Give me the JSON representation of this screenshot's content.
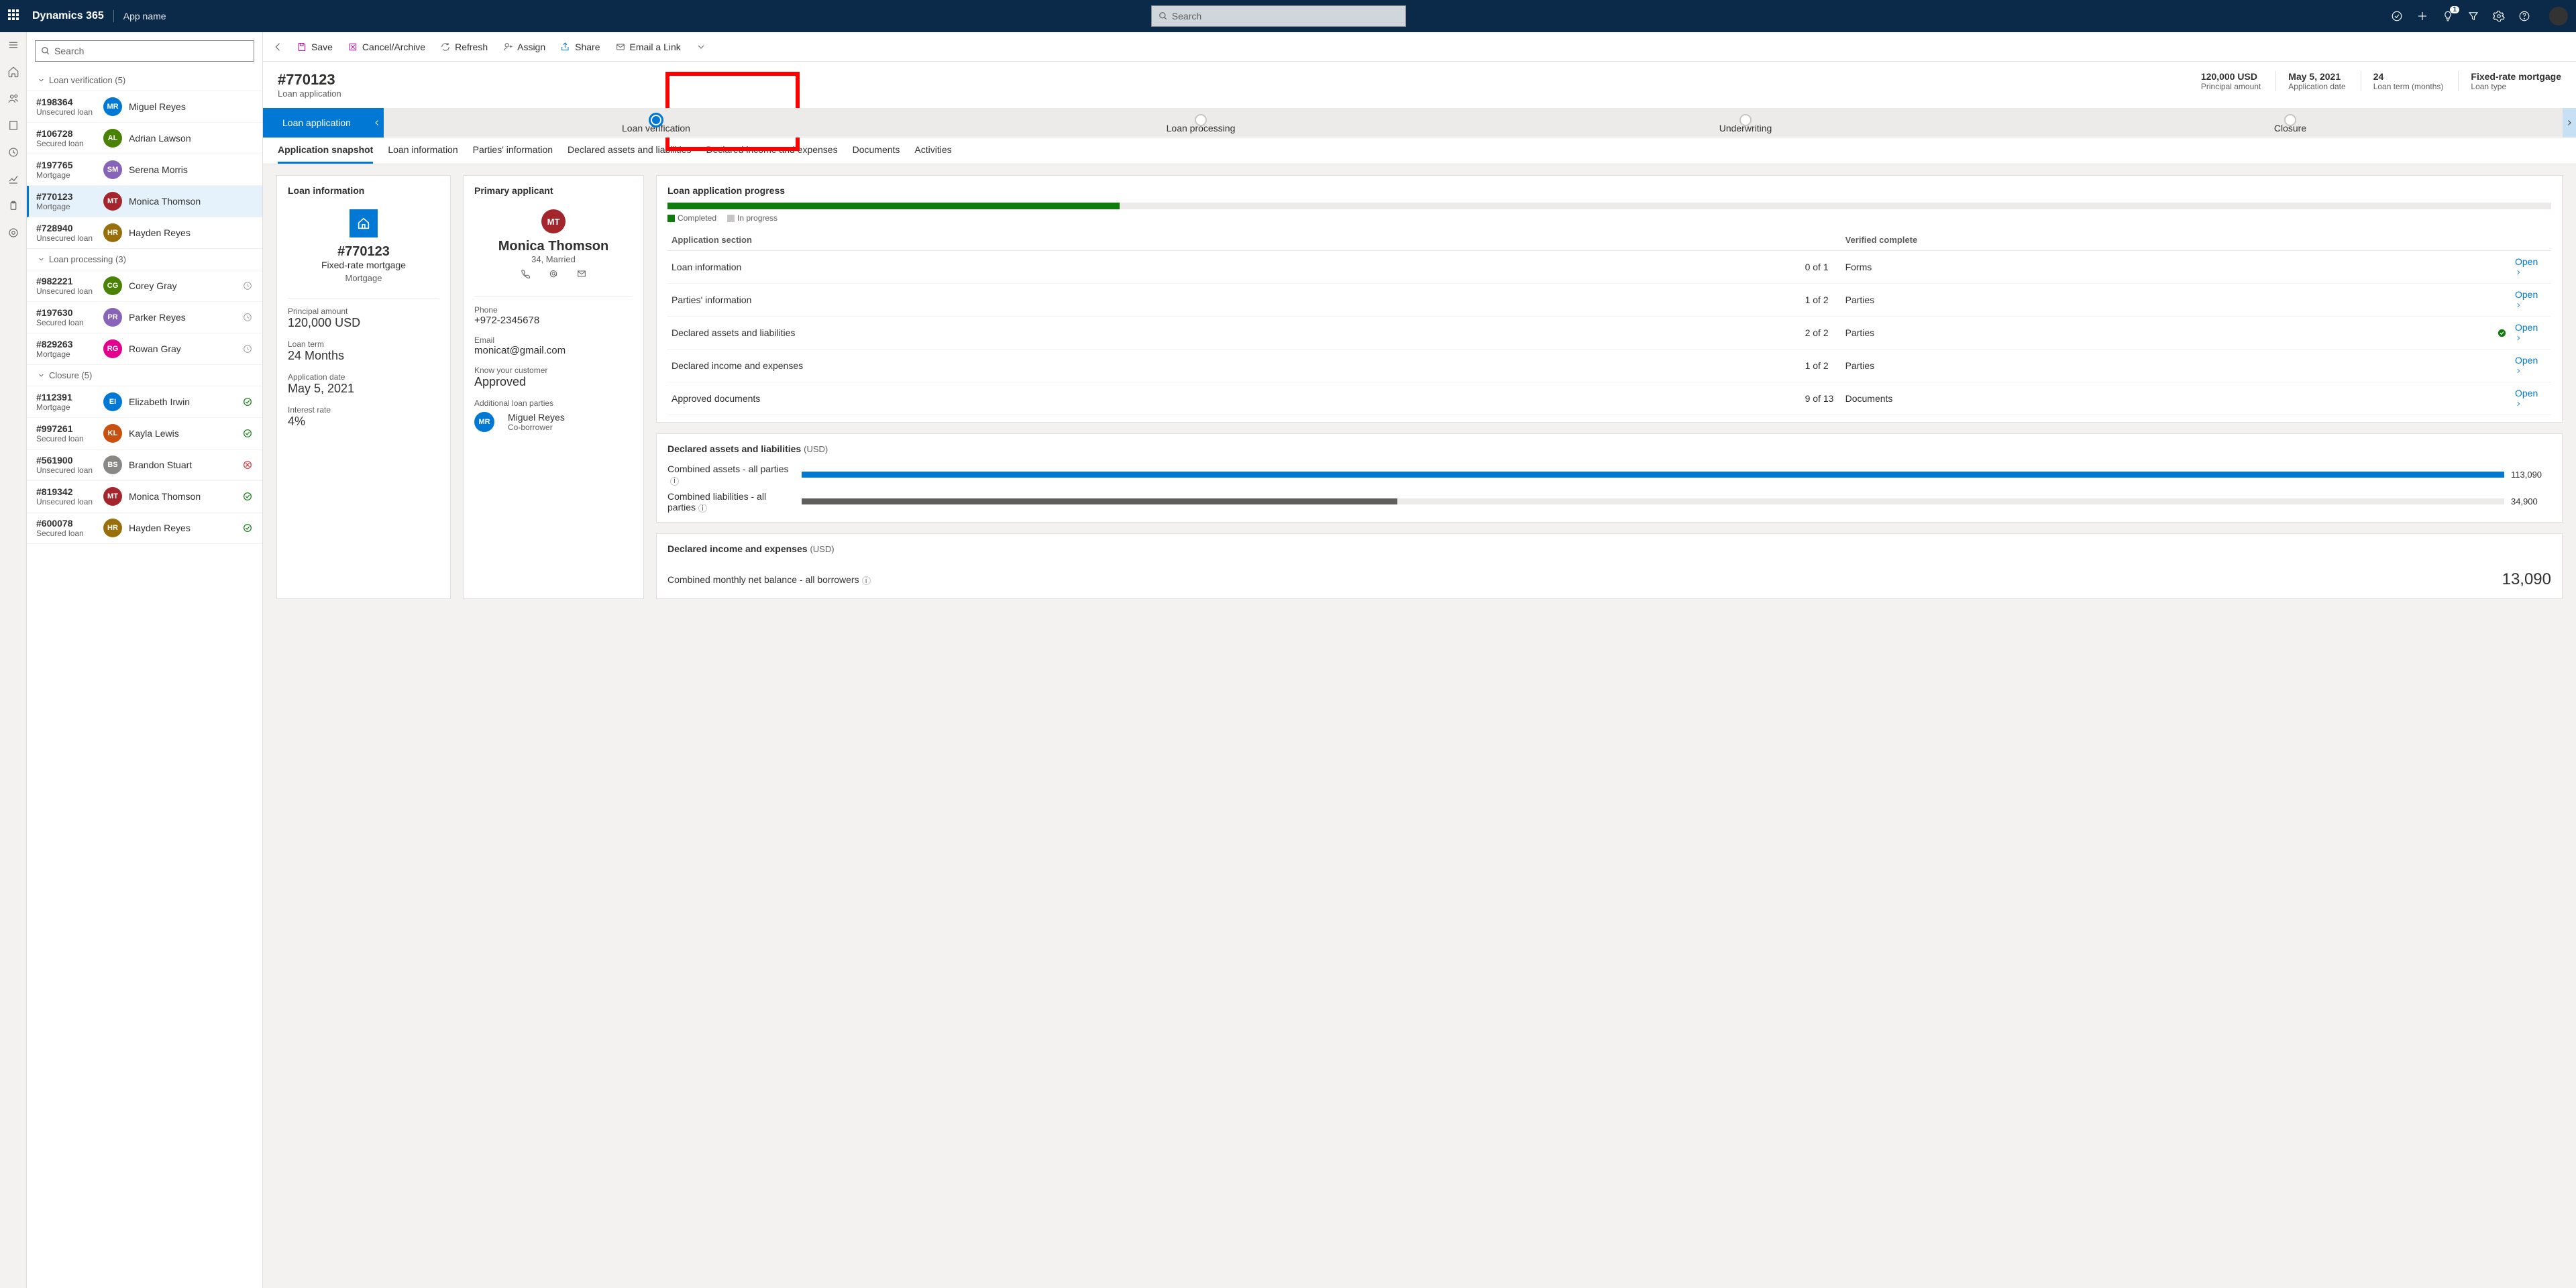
{
  "navbar": {
    "brand": "Dynamics 365",
    "app": "App name",
    "search_placeholder": "Search",
    "notification_count": "1"
  },
  "commands": {
    "save": "Save",
    "cancel": "Cancel/Archive",
    "refresh": "Refresh",
    "assign": "Assign",
    "share": "Share",
    "email": "Email a Link"
  },
  "list": {
    "search_placeholder": "Search",
    "groups": [
      {
        "title": "Loan verification (5)",
        "items": [
          {
            "id": "#198364",
            "type": "Unsecured loan",
            "name": "Miguel Reyes",
            "initials": "MR",
            "color": "#0078d4",
            "status": ""
          },
          {
            "id": "#106728",
            "type": "Secured loan",
            "name": "Adrian Lawson",
            "initials": "AL",
            "color": "#498205",
            "status": ""
          },
          {
            "id": "#197765",
            "type": "Mortgage",
            "name": "Serena Morris",
            "initials": "SM",
            "color": "#8764b8",
            "status": ""
          },
          {
            "id": "#770123",
            "type": "Mortgage",
            "name": "Monica Thomson",
            "initials": "MT",
            "color": "#a4262c",
            "status": "",
            "selected": true
          },
          {
            "id": "#728940",
            "type": "Unsecured loan",
            "name": "Hayden Reyes",
            "initials": "HR",
            "color": "#986f0b",
            "status": ""
          }
        ]
      },
      {
        "title": "Loan processing (3)",
        "items": [
          {
            "id": "#982221",
            "type": "Unsecured loan",
            "name": "Corey Gray",
            "initials": "CG",
            "color": "#498205",
            "status": "clock"
          },
          {
            "id": "#197630",
            "type": "Secured loan",
            "name": "Parker Reyes",
            "initials": "PR",
            "color": "#8764b8",
            "status": "clock"
          },
          {
            "id": "#829263",
            "type": "Mortgage",
            "name": "Rowan Gray",
            "initials": "RG",
            "color": "#e3008c",
            "status": "clock"
          }
        ]
      },
      {
        "title": "Closure (5)",
        "items": [
          {
            "id": "#112391",
            "type": "Mortgage",
            "name": "Elizabeth Irwin",
            "initials": "EI",
            "color": "#0078d4",
            "status": "check"
          },
          {
            "id": "#997261",
            "type": "Secured loan",
            "name": "Kayla Lewis",
            "initials": "KL",
            "color": "#ca5010",
            "status": "check"
          },
          {
            "id": "#561900",
            "type": "Unsecured loan",
            "name": "Brandon Stuart",
            "initials": "BS",
            "color": "#8a8886",
            "status": "error"
          },
          {
            "id": "#819342",
            "type": "Unsecured loan",
            "name": "Monica Thomson",
            "initials": "MT",
            "color": "#a4262c",
            "status": "check"
          },
          {
            "id": "#600078",
            "type": "Secured loan",
            "name": "Hayden Reyes",
            "initials": "HR",
            "color": "#986f0b",
            "status": "check"
          }
        ]
      }
    ]
  },
  "record": {
    "title": "#770123",
    "subtitle": "Loan application",
    "kpis": [
      {
        "value": "120,000 USD",
        "label": "Principal amount"
      },
      {
        "value": "May 5, 2021",
        "label": "Application date"
      },
      {
        "value": "24",
        "label": "Loan term (months)"
      },
      {
        "value": "Fixed-rate mortgage",
        "label": "Loan type"
      }
    ]
  },
  "bpf": {
    "first": "Loan application",
    "stages": [
      "Loan verification",
      "Loan processing",
      "Underwriting",
      "Closure"
    ],
    "active_index": 0
  },
  "tabs": [
    "Application snapshot",
    "Loan information",
    "Parties' information",
    "Declared assets and liabilities",
    "Declared income and expenses",
    "Documents",
    "Activities"
  ],
  "loan_info": {
    "heading": "Loan information",
    "id": "#770123",
    "product": "Fixed-rate mortgage",
    "category": "Mortgage",
    "principal_label": "Principal amount",
    "principal": "120,000 USD",
    "term_label": "Loan term",
    "term": "24 Months",
    "date_label": "Application date",
    "date": "May 5, 2021",
    "rate_label": "Interest rate",
    "rate": "4%"
  },
  "applicant": {
    "heading": "Primary applicant",
    "initials": "MT",
    "name": "Monica Thomson",
    "meta": "34, Married",
    "phone_label": "Phone",
    "phone": "+972-2345678",
    "email_label": "Email",
    "email": "monicat@gmail.com",
    "kyc_label": "Know your customer",
    "kyc": "Approved",
    "parties_label": "Additional loan parties",
    "party_initials": "MR",
    "party_name": "Miguel Reyes",
    "party_role": "Co-borrower"
  },
  "progress": {
    "heading": "Loan application progress",
    "pct": 24,
    "legend_completed": "Completed",
    "legend_inprogress": "In progress",
    "col1": "Application section",
    "col2": "Verified complete",
    "open": "Open",
    "rows": [
      {
        "section": "Loan information",
        "count": "0 of 1",
        "tab": "Forms",
        "check": false
      },
      {
        "section": "Parties' information",
        "count": "1 of 2",
        "tab": "Parties",
        "check": false
      },
      {
        "section": "Declared assets and liabilities",
        "count": "2 of 2",
        "tab": "Parties",
        "check": true
      },
      {
        "section": "Declared income and expenses",
        "count": "1 of 2",
        "tab": "Parties",
        "check": false
      },
      {
        "section": "Approved documents",
        "count": "9 of 13",
        "tab": "Documents",
        "check": false
      }
    ]
  },
  "assets": {
    "heading": "Declared assets and liabilities",
    "unit": "(USD)",
    "assets_label": "Combined assets - all parties",
    "assets_val": "113,090",
    "assets_pct": 100,
    "assets_color": "#0078d4",
    "liab_label": "Combined liabilities - all parties",
    "liab_val": "34,900",
    "liab_pct": 35,
    "liab_color": "#605e5c"
  },
  "income": {
    "heading": "Declared income and expenses",
    "unit": "(USD)",
    "label": "Combined monthly net balance - all borrowers",
    "value": "13,090"
  }
}
